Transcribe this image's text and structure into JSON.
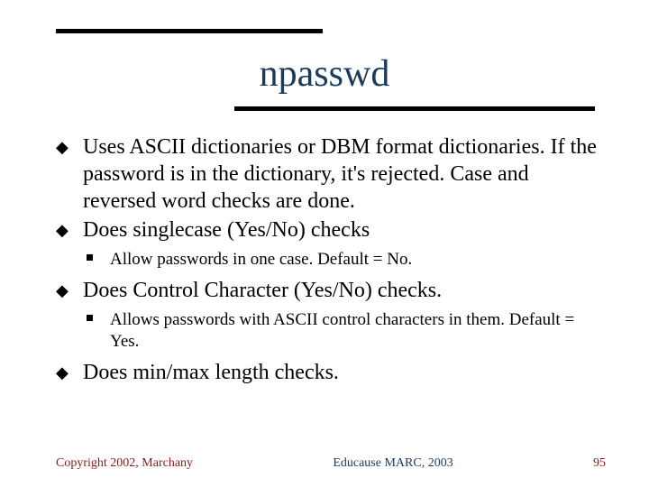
{
  "title": "npasswd",
  "bullets": [
    {
      "text": "Uses ASCII dictionaries or DBM format dictionaries. If the password is in the dictionary, it's rejected. Case and reversed word checks are done."
    },
    {
      "text": "Does singlecase (Yes/No) checks",
      "sub": [
        {
          "text": "Allow passwords in one case. Default = No."
        }
      ]
    },
    {
      "text": "Does Control Character (Yes/No) checks.",
      "sub": [
        {
          "text": "Allows passwords with ASCII control characters in them. Default = Yes."
        }
      ]
    },
    {
      "text": "Does min/max length checks."
    }
  ],
  "footer": {
    "left": "Educause MARC, 2003",
    "center": "Copyright 2002, Marchany",
    "right": "95"
  }
}
